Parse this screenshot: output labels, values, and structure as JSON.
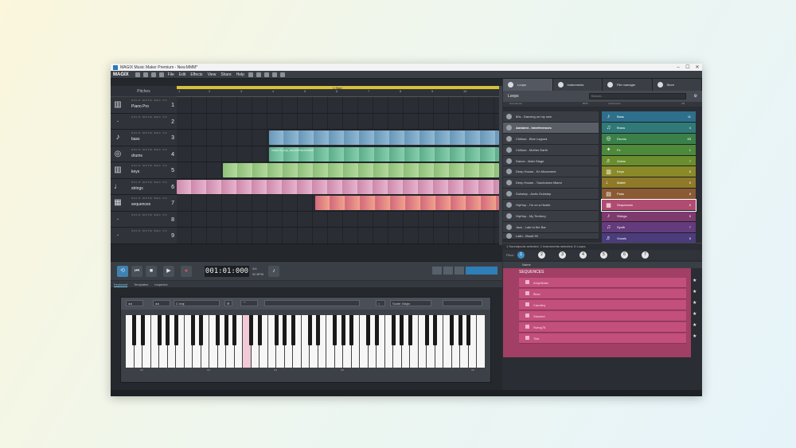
{
  "window": {
    "title": "MAGIX Music Maker Premium - New.MMM*",
    "min": "–",
    "max": "☐",
    "close": "✕"
  },
  "menubar": {
    "logo": "MAGIX",
    "menus": [
      "File",
      "Edit",
      "Effects",
      "View",
      "Share",
      "Help"
    ]
  },
  "arranger": {
    "tracklist_title": "Pitches",
    "ruler_marks": [
      "1",
      "2",
      "3",
      "4",
      "5",
      "6",
      "7",
      "8",
      "9",
      "10"
    ],
    "start_marker": "1 Start",
    "tracks": [
      {
        "name": "Piano Pro",
        "num": "1",
        "icon": "piano-icon",
        "glyph": "▥"
      },
      {
        "name": "",
        "num": "2",
        "icon": "empty-track-icon",
        "glyph": "·"
      },
      {
        "name": "bass",
        "num": "3",
        "icon": "guitar-icon",
        "glyph": "♪"
      },
      {
        "name": "drums",
        "num": "4",
        "icon": "drums-icon",
        "glyph": "◎"
      },
      {
        "name": "keys",
        "num": "5",
        "icon": "keyboard-icon",
        "glyph": "▥"
      },
      {
        "name": "strings",
        "num": "6",
        "icon": "violin-icon",
        "glyph": "♩"
      },
      {
        "name": "sequences",
        "num": "7",
        "icon": "sequencer-icon",
        "glyph": "▦"
      },
      {
        "name": "",
        "num": "8",
        "icon": "empty-track-icon",
        "glyph": "·"
      },
      {
        "name": "",
        "num": "9",
        "icon": "empty-track-icon",
        "glyph": "·"
      }
    ],
    "track_buttons": "SOLO  MUTE  REC  FX",
    "clip_label_drums": "Chillout D_sngL_NGLOOP BLOS MISS"
  },
  "transport": {
    "time": "001:01:000",
    "bpm_line1": "4/4",
    "bpm_line2": "90 BPM"
  },
  "lower": {
    "tabs": [
      "Keyboard",
      "Templates",
      "Inspector"
    ],
    "chord_select": "C maj",
    "scale_select": "Scale: Major",
    "octave_labels": [
      "C2",
      "C3",
      "C4",
      "C5",
      "C6"
    ]
  },
  "browser": {
    "tabs": [
      "Loops",
      "Instruments",
      "File manager",
      "Store"
    ],
    "section": "Loops",
    "search_placeholder": "Search...",
    "col_soundpools": "Soundpools",
    "col_bpm": "BPM",
    "col_instruments": "Instruments",
    "col_count": "2/8",
    "soundpools": [
      "80s - Dancing on my own",
      "Ambient - Interferences",
      "Chillout - Blue Laguna",
      "Chillout - Mother Earth",
      "Dance - Main Stage",
      "Deep House - En Movement",
      "Deep House - Touchdown Miami",
      "Dubstep - Arctic Dubstep",
      "HipHop - I'm on a Hustle",
      "HipHop - My Territory",
      "Jazz - Late in the Bar",
      "Latin - Brazil 90"
    ],
    "instruments": [
      {
        "name": "Bass",
        "count": "11",
        "color": "#2e6f8c",
        "glyph": "♪"
      },
      {
        "name": "Brass",
        "count": "4",
        "color": "#2f7a78",
        "glyph": "♫"
      },
      {
        "name": "Drums",
        "count": "83",
        "color": "#3b8049",
        "glyph": "◎"
      },
      {
        "name": "Fx",
        "count": "1",
        "color": "#4d8a3a",
        "glyph": "✦"
      },
      {
        "name": "Guitar",
        "count": "7",
        "color": "#6a8d2e",
        "glyph": "♬"
      },
      {
        "name": "Keys",
        "count": "6",
        "color": "#8a8a2a",
        "glyph": "▥"
      },
      {
        "name": "Mallet",
        "count": "5",
        "color": "#8f7a2a",
        "glyph": "♩"
      },
      {
        "name": "Pads",
        "count": "8",
        "color": "#8a5a34",
        "glyph": "▤"
      },
      {
        "name": "Sequences",
        "count": "6",
        "color": "#b04b72",
        "glyph": "▦"
      },
      {
        "name": "Strings",
        "count": "5",
        "color": "#7e3a6e",
        "glyph": "♪"
      },
      {
        "name": "Synth",
        "count": "7",
        "color": "#643b7c",
        "glyph": "♫"
      },
      {
        "name": "Vocals",
        "count": "6",
        "color": "#4b3c7c",
        "glyph": "♬"
      }
    ],
    "status": "1 Soundpools selected, 1 Instruments selected, 6 Loops.",
    "key_label": "Pitch:",
    "keys": [
      "1",
      "2",
      "3",
      "4",
      "5",
      "6",
      "7"
    ],
    "name_header": "Name",
    "category": "SEQUENCES",
    "sequences": [
      "Amphibian",
      "Blow",
      "Candleq",
      "Stacked",
      "Swing78",
      "Tide"
    ]
  }
}
